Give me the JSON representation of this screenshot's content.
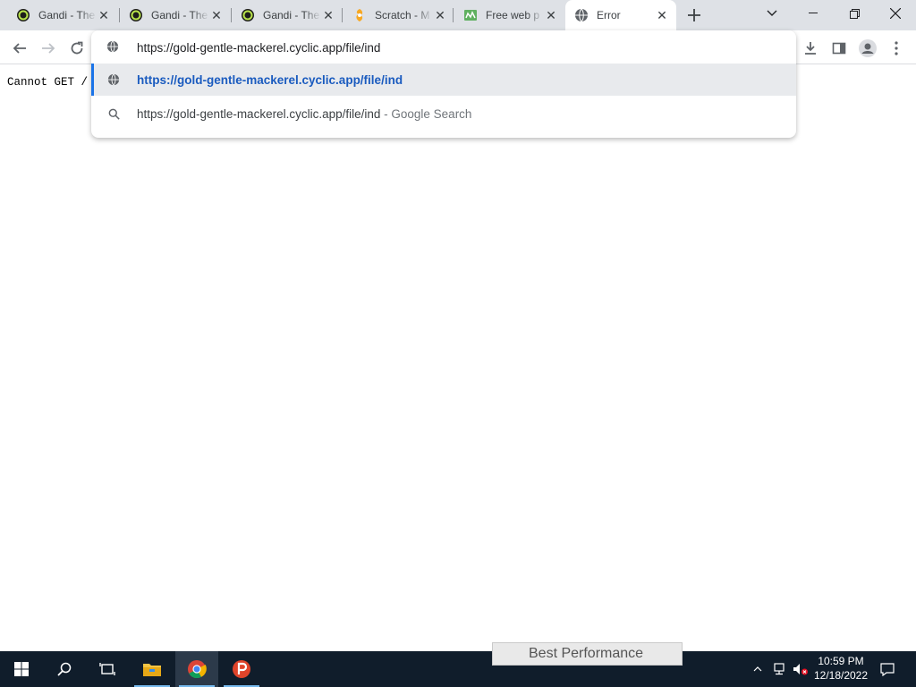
{
  "tabs": [
    {
      "title": "Gandi - The",
      "icon": "gandi-favicon",
      "close": "✕"
    },
    {
      "title": "Gandi - The",
      "icon": "gandi-favicon",
      "close": "✕"
    },
    {
      "title": "Gandi - The",
      "icon": "gandi-favicon",
      "close": "✕"
    },
    {
      "title": "Scratch - M",
      "icon": "scratch-favicon",
      "close": "✕"
    },
    {
      "title": "Free web p",
      "icon": "webpage-favicon",
      "close": "✕"
    },
    {
      "title": "Error",
      "icon": "globe-favicon",
      "close": "✕",
      "active": true
    }
  ],
  "omnibox": {
    "value": "https://gold-gentle-mackerel.cyclic.app/file/ind",
    "suggestions": [
      {
        "text": "https://gold-gentle-mackerel.cyclic.app/file/ind",
        "icon": "globe-icon",
        "selected": true
      },
      {
        "text": "https://gold-gentle-mackerel.cyclic.app/file/ind",
        "suffix": " - Google Search",
        "icon": "search-icon"
      }
    ]
  },
  "page": {
    "body_text": "Cannot GET /"
  },
  "taskbar": {
    "notification_text": "Best Performance",
    "clock_time": "10:59 PM",
    "clock_date": "12/18/2022"
  },
  "colors": {
    "tabstrip": "#dee1e6",
    "taskbar": "#101d2b",
    "accent": "#1a73e8"
  }
}
